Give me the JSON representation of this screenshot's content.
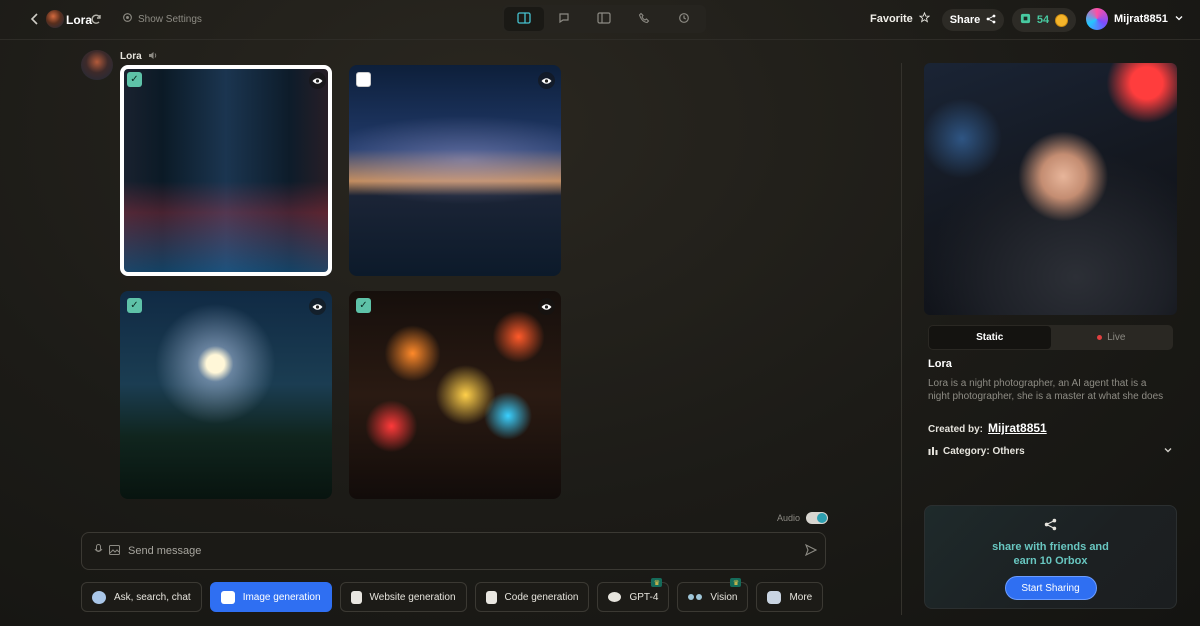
{
  "header": {
    "agent_name": "Lora",
    "settings_label": "Show Settings",
    "favorite_label": "Favorite",
    "share_label": "Share",
    "orbox_count": "54",
    "username": "Mijrat8851"
  },
  "chat": {
    "sender": "Lora",
    "images": [
      {
        "name": "rainy neon city street",
        "checked": true,
        "selected": true
      },
      {
        "name": "milky way over lake",
        "checked": false,
        "selected": false
      },
      {
        "name": "full moon over forest",
        "checked": true,
        "selected": false
      },
      {
        "name": "lantern night market",
        "checked": true,
        "selected": false
      }
    ],
    "audio_label": "Audio",
    "input_placeholder": "Send message"
  },
  "modes": [
    {
      "label": "Ask, search, chat",
      "icon": "chat-icon",
      "active": false
    },
    {
      "label": "Image generation",
      "icon": "image-icon",
      "active": true
    },
    {
      "label": "Website generation",
      "icon": "document-icon",
      "active": false
    },
    {
      "label": "Code generation",
      "icon": "document-icon",
      "active": false
    },
    {
      "label": "GPT-4",
      "icon": "chat-bubble-icon",
      "active": false,
      "premium": true
    },
    {
      "label": "Vision",
      "icon": "eyes-icon",
      "active": false,
      "premium": true
    },
    {
      "label": "More",
      "icon": "more-icon",
      "active": false
    }
  ],
  "agent": {
    "tabs": [
      "Static",
      "Live"
    ],
    "active_tab": "Static",
    "name": "Lora",
    "description": "Lora is a night photographer, an AI agent that is a night photographer, she is a master at what she does",
    "created_by_label": "Created by:",
    "creator": "Mijrat8851",
    "category_label": "Category: Others"
  },
  "share_card": {
    "text": "share with friends and earn 10 Orbox",
    "button": "Start Sharing"
  },
  "colors": {
    "accent": "#2f6ff2",
    "teal": "#46c2d0",
    "orbox": "#48c9a0",
    "background": "#1c1b17"
  }
}
